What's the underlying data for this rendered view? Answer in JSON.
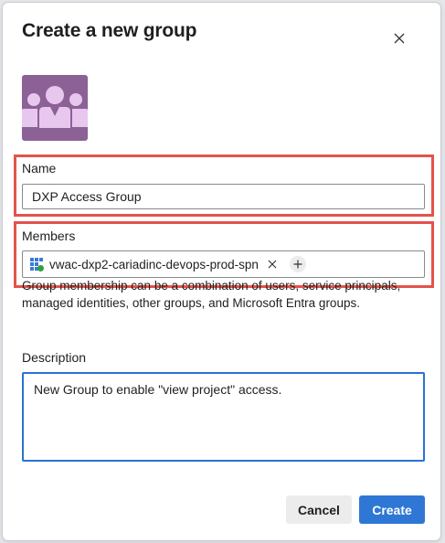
{
  "dialog": {
    "title": "Create a new group",
    "close_icon": "close-icon"
  },
  "avatar": {
    "icon": "group-avatar-icon",
    "color": "#8b6196"
  },
  "name_field": {
    "label": "Name",
    "value": "DXP Access Group"
  },
  "members_field": {
    "label": "Members",
    "members": [
      {
        "name": "vwac-dxp2-cariadinc-devops-prod-spn",
        "icon": "service-principal-icon"
      }
    ],
    "add_icon": "add-icon",
    "helper_text": "Group membership can be a combination of users, service principals, managed identities, other groups, and Microsoft Entra groups."
  },
  "description_field": {
    "label": "Description",
    "value": "New Group to enable \"view project\" access."
  },
  "buttons": {
    "cancel": "Cancel",
    "create": "Create"
  },
  "colors": {
    "accent": "#2f77d4",
    "highlight": "#e3534a"
  }
}
